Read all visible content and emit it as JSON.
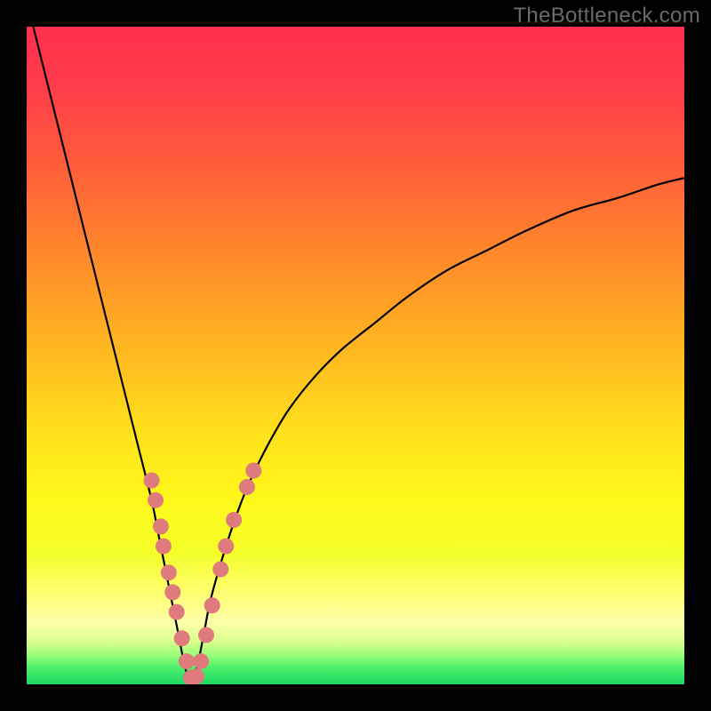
{
  "watermark": "TheBottleneck.com",
  "colors": {
    "frame": "#000000",
    "gradient_stops": [
      {
        "offset": 0.0,
        "color": "#ff2f4e"
      },
      {
        "offset": 0.08,
        "color": "#ff3a4b"
      },
      {
        "offset": 0.2,
        "color": "#ff5a3c"
      },
      {
        "offset": 0.35,
        "color": "#ff8a2a"
      },
      {
        "offset": 0.5,
        "color": "#ffba20"
      },
      {
        "offset": 0.62,
        "color": "#ffe21c"
      },
      {
        "offset": 0.72,
        "color": "#fff81a"
      },
      {
        "offset": 0.8,
        "color": "#f3ff28"
      },
      {
        "offset": 0.86,
        "color": "#ffff70"
      },
      {
        "offset": 0.905,
        "color": "#ffffaa"
      },
      {
        "offset": 0.935,
        "color": "#d8ff8e"
      },
      {
        "offset": 0.955,
        "color": "#9cff7a"
      },
      {
        "offset": 0.975,
        "color": "#4cf06c"
      },
      {
        "offset": 1.0,
        "color": "#1fd862"
      }
    ],
    "curve": "#000000",
    "dot": "#e07b7d"
  },
  "chart_data": {
    "type": "line",
    "title": "",
    "xlabel": "",
    "ylabel": "",
    "xlim": [
      0,
      100
    ],
    "ylim": [
      0,
      100
    ],
    "series": [
      {
        "name": "bottleneck-curve",
        "x": [
          1,
          3,
          5,
          7,
          9,
          11,
          13,
          15,
          17,
          19,
          20,
          21,
          22,
          23,
          24,
          25,
          26,
          27,
          28,
          30,
          32,
          34,
          37,
          40,
          44,
          48,
          53,
          58,
          64,
          70,
          76,
          83,
          90,
          96,
          100
        ],
        "y": [
          100,
          92,
          84,
          76,
          68,
          60,
          52,
          44,
          36,
          28,
          23,
          18,
          13,
          8,
          3,
          0,
          3,
          8,
          13,
          20,
          26,
          31,
          37,
          42,
          47,
          51,
          55,
          59,
          63,
          66,
          69,
          72,
          74,
          76,
          77
        ]
      }
    ],
    "scatter_points": {
      "name": "highlight-dots",
      "points": [
        {
          "x": 19.0,
          "y": 31.0
        },
        {
          "x": 19.6,
          "y": 28.0
        },
        {
          "x": 20.4,
          "y": 24.0
        },
        {
          "x": 20.8,
          "y": 21.0
        },
        {
          "x": 21.6,
          "y": 17.0
        },
        {
          "x": 22.2,
          "y": 14.0
        },
        {
          "x": 22.8,
          "y": 11.0
        },
        {
          "x": 23.6,
          "y": 7.0
        },
        {
          "x": 24.3,
          "y": 3.5
        },
        {
          "x": 25.0,
          "y": 1.0
        },
        {
          "x": 25.8,
          "y": 1.2
        },
        {
          "x": 26.5,
          "y": 3.5
        },
        {
          "x": 27.3,
          "y": 7.5
        },
        {
          "x": 28.2,
          "y": 12.0
        },
        {
          "x": 29.5,
          "y": 17.5
        },
        {
          "x": 30.3,
          "y": 21.0
        },
        {
          "x": 31.5,
          "y": 25.0
        },
        {
          "x": 33.5,
          "y": 30.0
        },
        {
          "x": 34.5,
          "y": 32.5
        }
      ]
    }
  }
}
